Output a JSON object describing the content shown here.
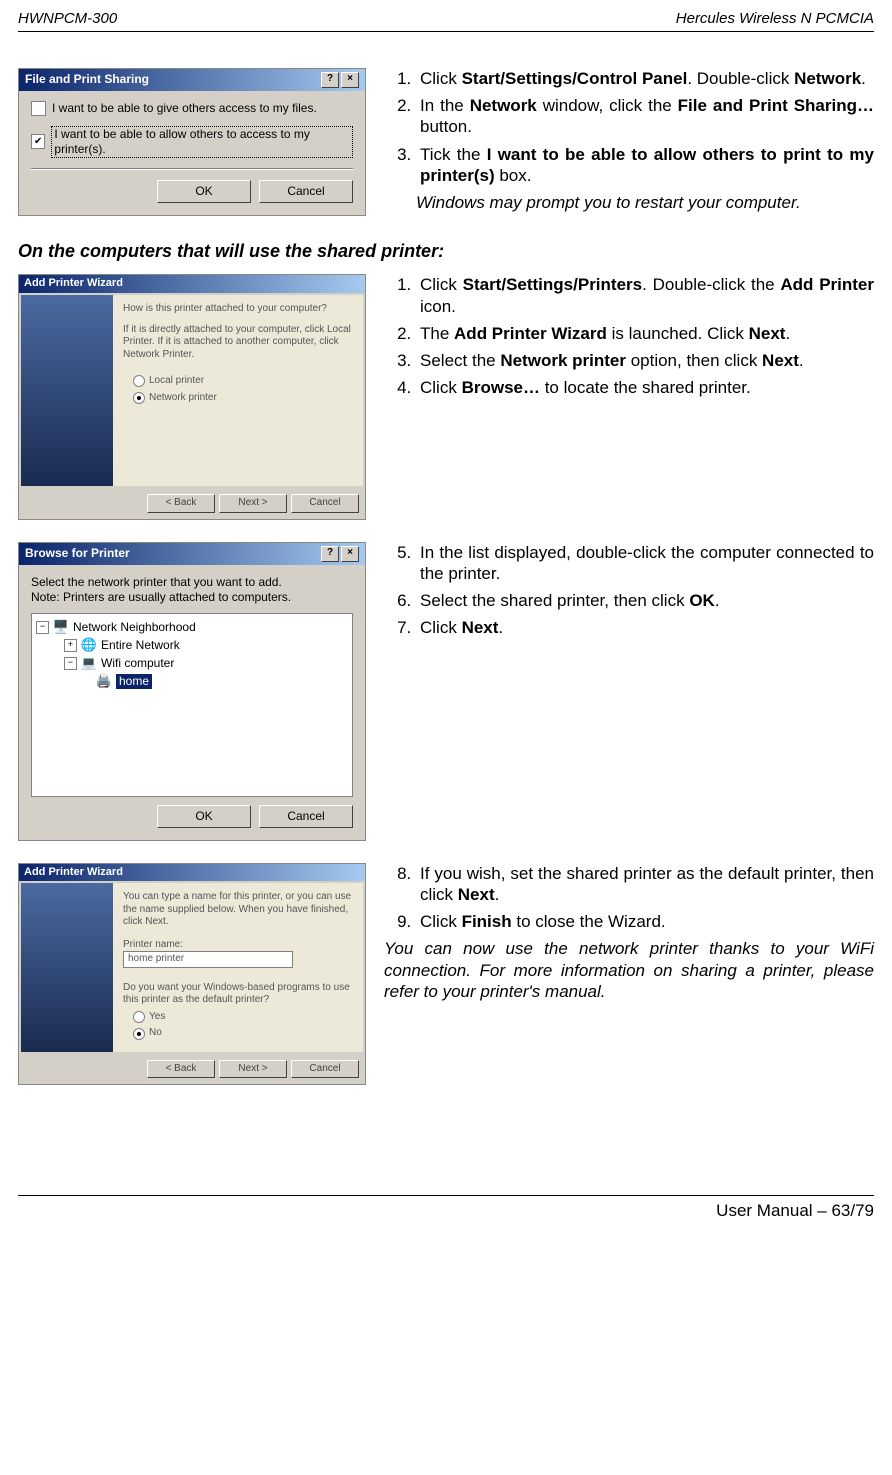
{
  "header": {
    "left": "HWNPCM-300",
    "right": "Hercules Wireless N PCMCIA"
  },
  "footer": {
    "text": "User Manual – 63/79"
  },
  "dlg1": {
    "title": "File and Print Sharing",
    "chk1": "I want to be able to give others access to my files.",
    "chk2": "I want to be able to allow others to access to my printer(s).",
    "ok": "OK",
    "cancel": "Cancel",
    "help_btn": "?",
    "close_btn": "×"
  },
  "steps1": {
    "s1a": "Click ",
    "s1b": "Start/Settings/Control Panel",
    "s1c": ".  Double-click ",
    "s1d": "Network",
    "s1e": ".",
    "s2a": "In the ",
    "s2b": "Network",
    "s2c": " window, click the ",
    "s2d": "File and Print Sharing…",
    "s2e": " button.",
    "s3a": "Tick the ",
    "s3b": "I want to be able to allow others to print to my printer(s)",
    "s3c": " box.",
    "note": "Windows may prompt you to restart your computer."
  },
  "subhead": "On the computers that will use the shared printer:",
  "wiz1": {
    "title": "Add Printer Wizard",
    "q": "How is this printer attached to your computer?",
    "desc": "If it is directly attached to your computer, click Local Printer. If it is attached to another computer, click Network Printer.",
    "opt1": "Local printer",
    "opt2": "Network printer",
    "back": "< Back",
    "next": "Next >",
    "cancel": "Cancel"
  },
  "steps2": {
    "s1a": "Click ",
    "s1b": "Start/Settings/Printers",
    "s1c": ".  Double-click the ",
    "s1d": "Add Printer",
    "s1e": " icon.",
    "s2a": "The ",
    "s2b": "Add Printer Wizard",
    "s2c": " is launched.  Click ",
    "s2d": "Next",
    "s2e": ".",
    "s3a": "Select the ",
    "s3b": "Network printer",
    "s3c": " option, then click ",
    "s3d": "Next",
    "s3e": ".",
    "s4a": "Click ",
    "s4b": "Browse…",
    "s4c": " to locate the shared printer."
  },
  "dlg2": {
    "title": "Browse for Printer",
    "line1": "Select the network printer that you want to add.",
    "line2": "Note: Printers are usually attached to computers.",
    "node1": "Network Neighborhood",
    "node2": "Entire Network",
    "node3": "Wifi computer",
    "node4": "home",
    "ok": "OK",
    "cancel": "Cancel",
    "help_btn": "?",
    "close_btn": "×"
  },
  "steps3": {
    "s5a": "In the list displayed, double-click the computer connected to the printer.",
    "s6a": "Select the shared printer, then click ",
    "s6b": "OK",
    "s6c": ".",
    "s7a": "Click ",
    "s7b": "Next",
    "s7c": "."
  },
  "wiz2": {
    "title": "Add Printer Wizard",
    "desc": "You can type a name for this printer, or you can use the name supplied below. When you have finished, click Next.",
    "pname_label": "Printer name:",
    "pname_value": "home printer",
    "q2": "Do you want your Windows-based programs to use this printer as the default printer?",
    "yes": "Yes",
    "no": "No",
    "back": "< Back",
    "next": "Next >",
    "cancel": "Cancel"
  },
  "steps4": {
    "s8a": "If you wish, set the shared printer as the default printer, then click ",
    "s8b": "Next",
    "s8c": ".",
    "s9a": "Click ",
    "s9b": "Finish",
    "s9c": " to close the Wizard.",
    "note": "You can now use the network printer thanks to your WiFi connection.  For more information on sharing a printer, please refer to your printer's manual."
  }
}
